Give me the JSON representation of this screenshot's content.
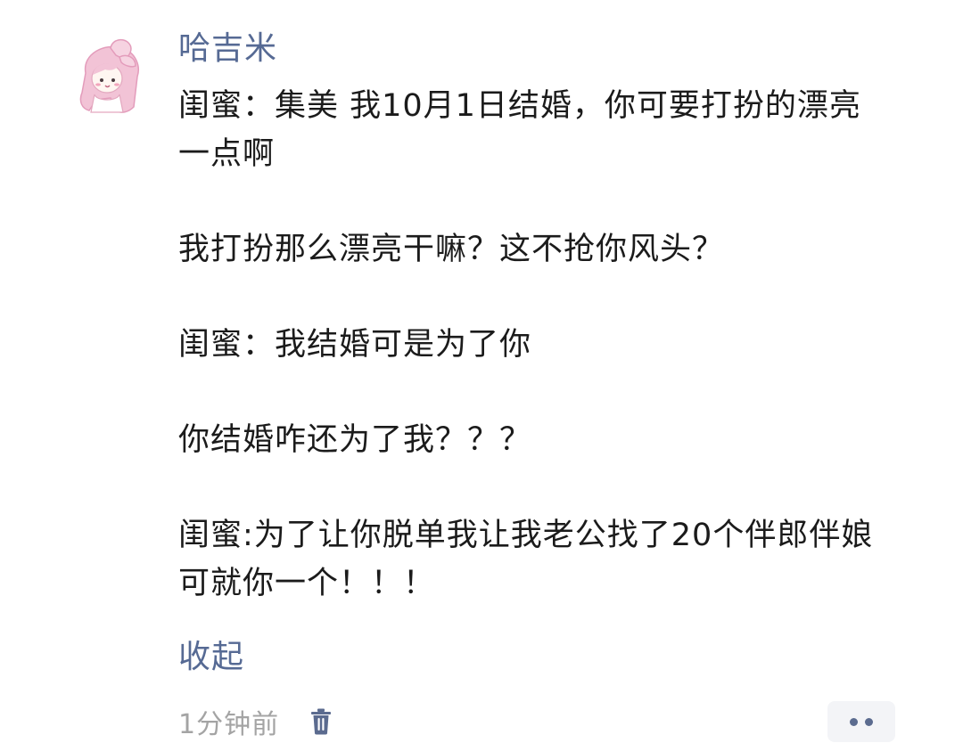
{
  "comment": {
    "username": "哈吉米",
    "paragraphs": [
      "闺蜜：集美 我10月1日结婚，你可要打扮的漂亮一点啊",
      "我打扮那么漂亮干嘛？这不抢你风头？",
      "闺蜜：我结婚可是为了你",
      "你结婚咋还为了我？？？",
      "闺蜜:为了让你脱单我让我老公找了20个伴郎伴娘可就你一个！！！"
    ],
    "collapse_label": "收起",
    "time": "1分钟前"
  },
  "icons": {
    "avatar": "avatar-cartoon-girl",
    "delete": "trash-icon",
    "more": "more-dots-icon"
  },
  "colors": {
    "link": "#566a94",
    "text": "#1b1b1b",
    "meta": "#a4a4a4",
    "more_bg": "#f3f4f7"
  }
}
